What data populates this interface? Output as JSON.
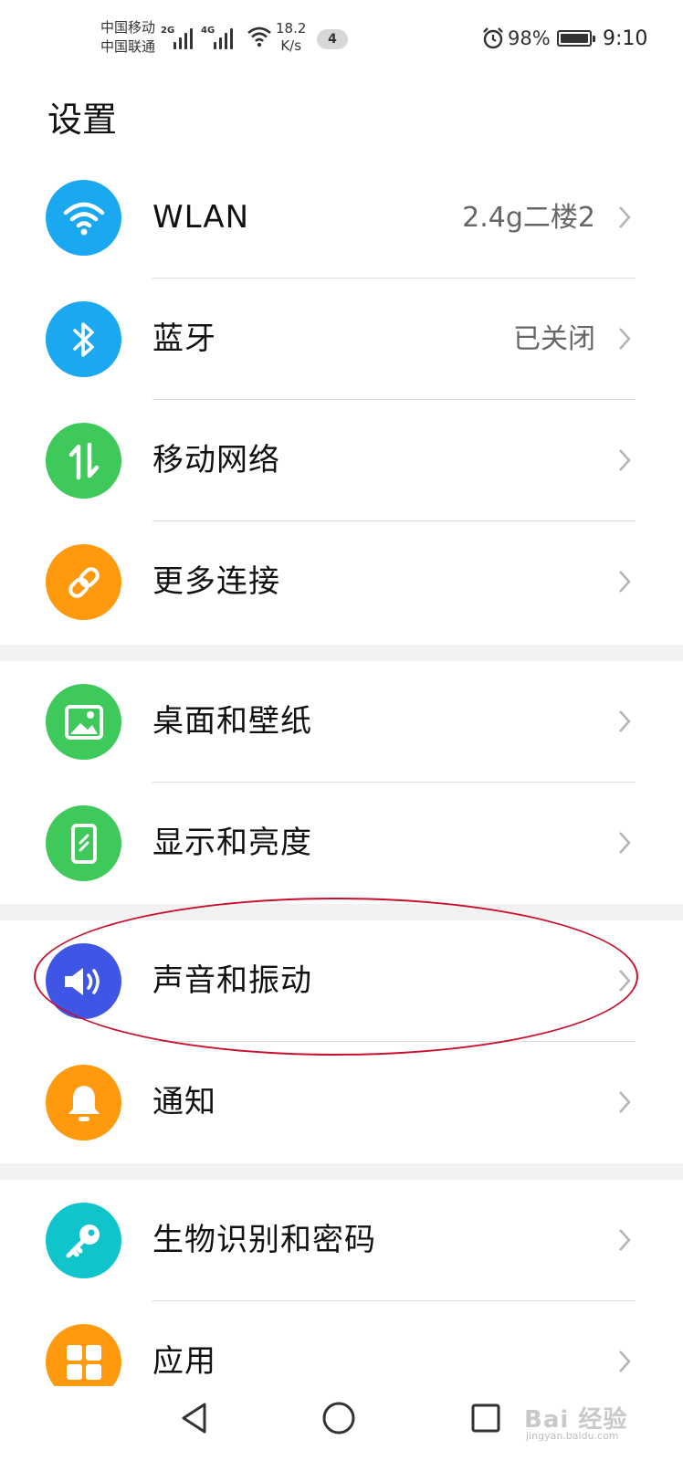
{
  "status_bar": {
    "carrier_1": "中国移动",
    "carrier_2": "中国联通",
    "sig1_tag": "2G",
    "sig2_tag": "4G",
    "speed_value": "18.2",
    "speed_unit": "K/s",
    "notif_count": "4",
    "battery": "98%",
    "time": "9:10"
  },
  "title": "设置",
  "items": [
    {
      "label": "WLAN",
      "value": "2.4g二楼2",
      "color": "#1aa8f0",
      "icon": "wifi-icon"
    },
    {
      "label": "蓝牙",
      "value": "已关闭",
      "color": "#1aa8f0",
      "icon": "bluetooth-icon"
    },
    {
      "label": "移动网络",
      "value": "",
      "color": "#3ec95a",
      "icon": "mobile-data-icon"
    },
    {
      "label": "更多连接",
      "value": "",
      "color": "#ff9a0e",
      "icon": "link-icon"
    },
    {
      "label": "桌面和壁纸",
      "value": "",
      "color": "#3ec95a",
      "icon": "image-icon"
    },
    {
      "label": "显示和亮度",
      "value": "",
      "color": "#3ec95a",
      "icon": "phone-display-icon"
    },
    {
      "label": "声音和振动",
      "value": "",
      "color": "#3f55e6",
      "icon": "speaker-icon"
    },
    {
      "label": "通知",
      "value": "",
      "color": "#ff9a0e",
      "icon": "bell-icon"
    },
    {
      "label": "生物识别和密码",
      "value": "",
      "color": "#10c4cc",
      "icon": "key-icon"
    },
    {
      "label": "应用",
      "value": "",
      "color": "#ff9a0e",
      "icon": "apps-grid-icon"
    }
  ],
  "watermark": {
    "main": "Bai 经验",
    "sub": "jingyan.baidu.com"
  },
  "colors": {
    "highlight": "#c8102e",
    "section_gap": "#f2f2f2"
  }
}
